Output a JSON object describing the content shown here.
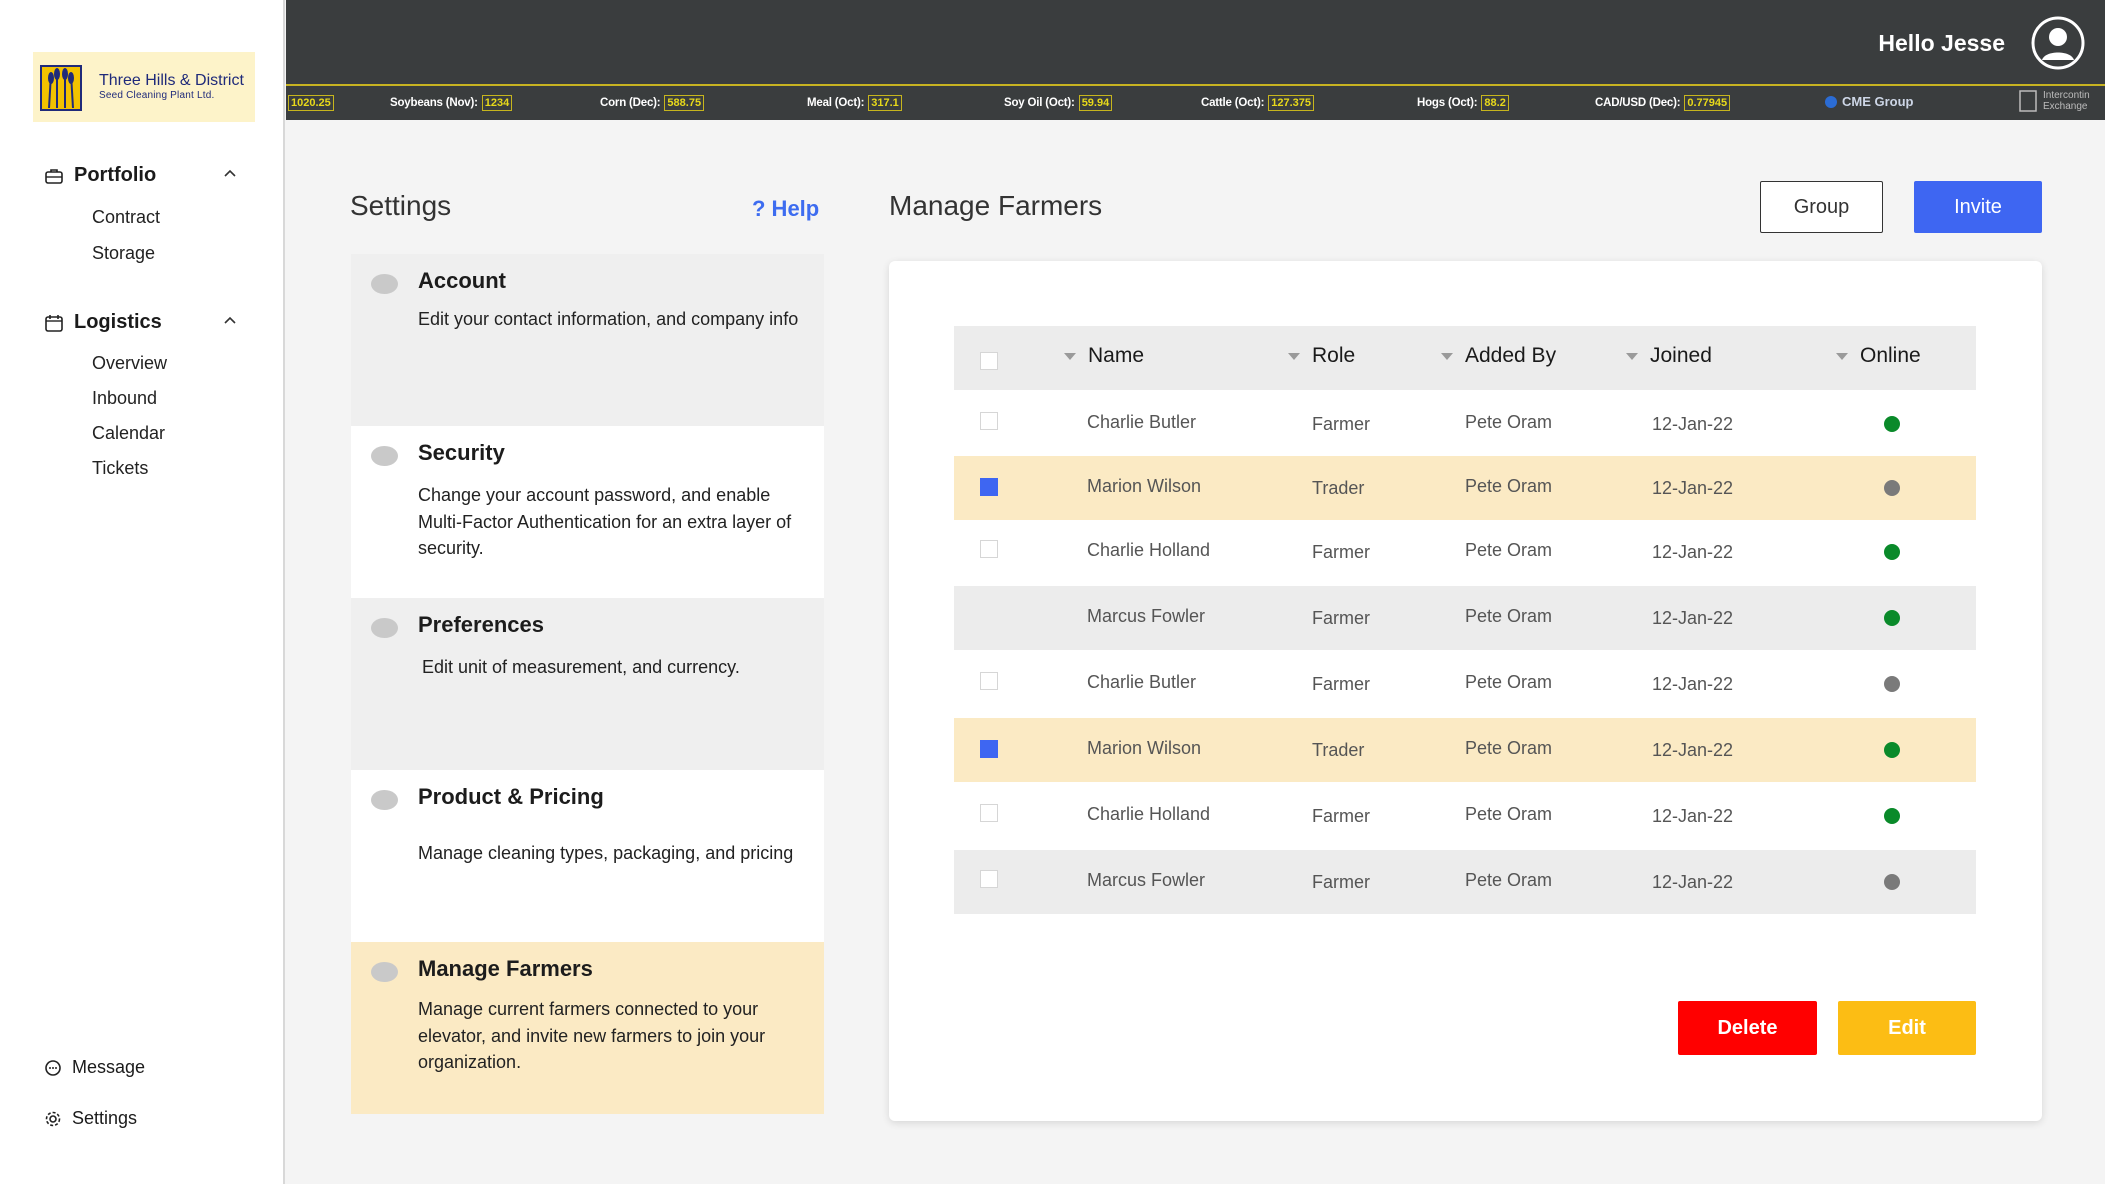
{
  "brand": {
    "name": "Three Hills & District",
    "subtitle": "Seed Cleaning Plant Ltd."
  },
  "header": {
    "greeting": "Hello Jesse"
  },
  "ticker": {
    "first_value": "1020.25",
    "items": [
      {
        "label": "Soybeans (Nov):",
        "value": "1234"
      },
      {
        "label": "Corn (Dec):",
        "value": "588.75"
      },
      {
        "label": "Meal (Oct):",
        "value": "317.1"
      },
      {
        "label": "Soy Oil (Oct):",
        "value": "59.94"
      },
      {
        "label": "Cattle (Oct):",
        "value": "127.375"
      },
      {
        "label": "Hogs (Oct):",
        "value": "88.2"
      },
      {
        "label": "CAD/USD (Dec):",
        "value": "0.77945"
      }
    ],
    "cme": "CME Group",
    "ice_line1": "Intercontin",
    "ice_line2": "Exchange"
  },
  "sidebar": {
    "portfolio": {
      "label": "Portfolio",
      "items": [
        "Contract",
        "Storage"
      ]
    },
    "logistics": {
      "label": "Logistics",
      "items": [
        "Overview",
        "Inbound",
        "Calendar",
        "Tickets"
      ]
    },
    "message": "Message",
    "settings": "Settings"
  },
  "settings": {
    "title": "Settings",
    "help": "? Help",
    "cards": [
      {
        "title": "Account",
        "desc": "Edit your contact information, and company info"
      },
      {
        "title": "Security",
        "desc": "Change your account password, and enable Multi-Factor Authentication for an extra layer of security."
      },
      {
        "title": "Preferences",
        "desc": "Edit unit of measurement, and currency."
      },
      {
        "title": "Product & Pricing",
        "desc": "Manage cleaning types, packaging, and pricing"
      },
      {
        "title": "Manage Farmers",
        "desc": "Manage current farmers connected to your elevator, and invite new farmers to join your organization."
      }
    ]
  },
  "farmers": {
    "title": "Manage Farmers",
    "group_label": "Group",
    "invite_label": "Invite",
    "columns": {
      "name": "Name",
      "role": "Role",
      "added_by": "Added By",
      "joined": "Joined",
      "online": "Online"
    },
    "rows": [
      {
        "name": "Charlie Butler",
        "role": "Farmer",
        "added_by": "Pete Oram",
        "joined": "12-Jan-22",
        "online": true,
        "checked": false
      },
      {
        "name": "Marion Wilson",
        "role": "Trader",
        "added_by": "Pete Oram",
        "joined": "12-Jan-22",
        "online": false,
        "checked": true
      },
      {
        "name": "Charlie Holland",
        "role": "Farmer",
        "added_by": "Pete Oram",
        "joined": "12-Jan-22",
        "online": true,
        "checked": false
      },
      {
        "name": "Marcus Fowler",
        "role": "Farmer",
        "added_by": "Pete Oram",
        "joined": "12-Jan-22",
        "online": true,
        "checked": false
      },
      {
        "name": "Charlie Butler",
        "role": "Farmer",
        "added_by": "Pete Oram",
        "joined": "12-Jan-22",
        "online": false,
        "checked": false
      },
      {
        "name": "Marion Wilson",
        "role": "Trader",
        "added_by": "Pete Oram",
        "joined": "12-Jan-22",
        "online": true,
        "checked": true
      },
      {
        "name": "Charlie Holland",
        "role": "Farmer",
        "added_by": "Pete Oram",
        "joined": "12-Jan-22",
        "online": true,
        "checked": false
      },
      {
        "name": "Marcus Fowler",
        "role": "Farmer",
        "added_by": "Pete Oram",
        "joined": "12-Jan-22",
        "online": false,
        "checked": false
      }
    ],
    "delete_label": "Delete",
    "edit_label": "Edit"
  },
  "colors": {
    "accent": "#3e66f2",
    "online": "#0a8a2a",
    "offline": "#7a7a7a",
    "selected_row": "#fbeac4",
    "delete": "#ff0000",
    "edit": "#fcbd14"
  }
}
